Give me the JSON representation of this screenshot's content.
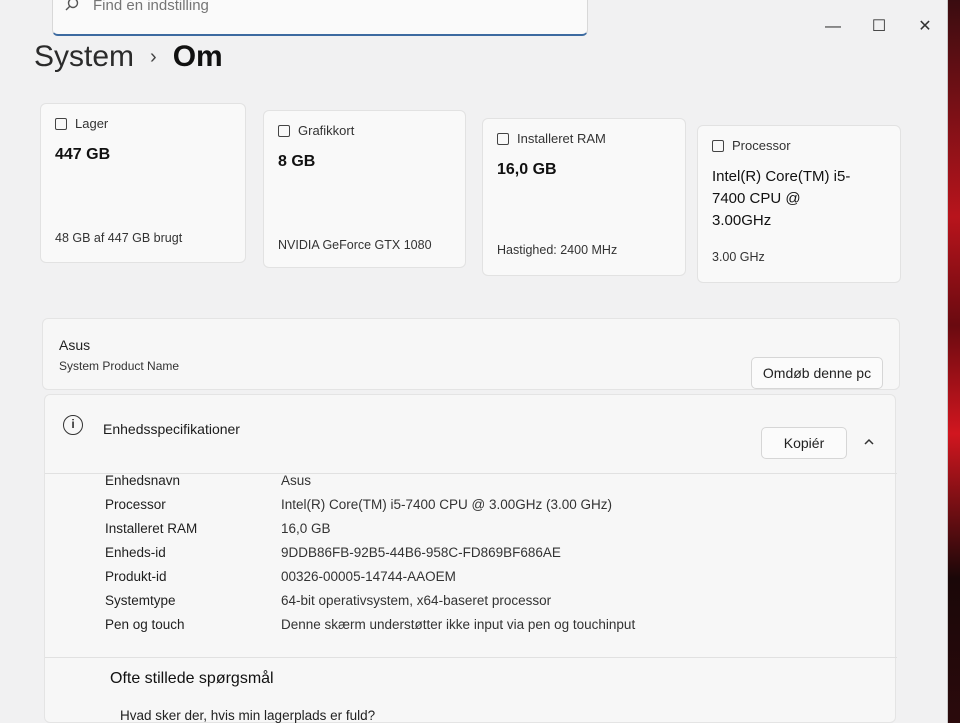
{
  "search": {
    "placeholder": "Find en indstilling"
  },
  "window_controls": {
    "minimize": "—",
    "maximize": "☐",
    "close": "✕"
  },
  "breadcrumb": {
    "parent": "System",
    "separator": "›",
    "current": "Om"
  },
  "cards": [
    {
      "icon": "storage-icon",
      "label": "Lager",
      "value": "447 GB",
      "detail": "48 GB af 447 GB brugt"
    },
    {
      "icon": "graphics-card-icon",
      "label": "Grafikkort",
      "value": "8 GB",
      "detail": "NVIDIA GeForce GTX 1080"
    },
    {
      "icon": "ram-icon",
      "label": "Installeret RAM",
      "value": "16,0 GB",
      "detail": "Hastighed: 2400 MHz"
    },
    {
      "icon": "processor-icon",
      "label": "Processor",
      "value": "Intel(R) Core(TM) i5-7400 CPU @ 3.00GHz",
      "detail": "3.00 GHz"
    }
  ],
  "product": {
    "brand": "Asus",
    "name": "System Product Name",
    "rename_label": "Omdøb denne pc"
  },
  "specs": {
    "title": "Enhedsspecifikationer",
    "copy_label": "Kopiér",
    "rows": [
      {
        "key": "Enhedsnavn",
        "value": "Asus"
      },
      {
        "key": "Processor",
        "value": "Intel(R) Core(TM) i5-7400 CPU @ 3.00GHz (3.00 GHz)"
      },
      {
        "key": "Installeret RAM",
        "value": "16,0 GB"
      },
      {
        "key": "Enheds-id",
        "value": "9DDB86FB-92B5-44B6-958C-FD869BF686AE"
      },
      {
        "key": "Produkt-id",
        "value": "00326-00005-14744-AAOEM"
      },
      {
        "key": "Systemtype",
        "value": "64-bit operativsystem, x64-baseret processor"
      },
      {
        "key": "Pen og touch",
        "value": "Denne skærm understøtter ikke input via pen og touchinput"
      }
    ]
  },
  "faq": {
    "title": "Ofte stillede spørgsmål",
    "first_question": "Hvad sker der, hvis min lagerplads er fuld?"
  }
}
